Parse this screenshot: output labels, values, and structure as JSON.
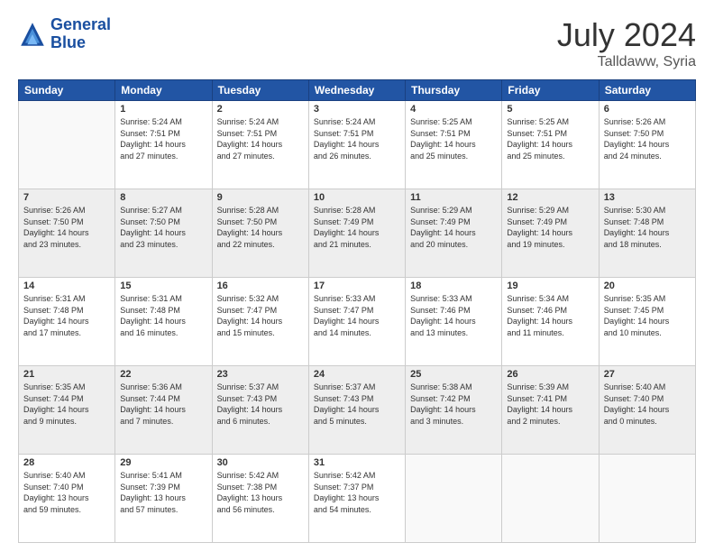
{
  "header": {
    "logo_line1": "General",
    "logo_line2": "Blue",
    "month_year": "July 2024",
    "location": "Talldaww, Syria"
  },
  "weekdays": [
    "Sunday",
    "Monday",
    "Tuesday",
    "Wednesday",
    "Thursday",
    "Friday",
    "Saturday"
  ],
  "weeks": [
    [
      {
        "day": "",
        "info": ""
      },
      {
        "day": "1",
        "info": "Sunrise: 5:24 AM\nSunset: 7:51 PM\nDaylight: 14 hours\nand 27 minutes."
      },
      {
        "day": "2",
        "info": "Sunrise: 5:24 AM\nSunset: 7:51 PM\nDaylight: 14 hours\nand 27 minutes."
      },
      {
        "day": "3",
        "info": "Sunrise: 5:24 AM\nSunset: 7:51 PM\nDaylight: 14 hours\nand 26 minutes."
      },
      {
        "day": "4",
        "info": "Sunrise: 5:25 AM\nSunset: 7:51 PM\nDaylight: 14 hours\nand 25 minutes."
      },
      {
        "day": "5",
        "info": "Sunrise: 5:25 AM\nSunset: 7:51 PM\nDaylight: 14 hours\nand 25 minutes."
      },
      {
        "day": "6",
        "info": "Sunrise: 5:26 AM\nSunset: 7:50 PM\nDaylight: 14 hours\nand 24 minutes."
      }
    ],
    [
      {
        "day": "7",
        "info": "Sunrise: 5:26 AM\nSunset: 7:50 PM\nDaylight: 14 hours\nand 23 minutes."
      },
      {
        "day": "8",
        "info": "Sunrise: 5:27 AM\nSunset: 7:50 PM\nDaylight: 14 hours\nand 23 minutes."
      },
      {
        "day": "9",
        "info": "Sunrise: 5:28 AM\nSunset: 7:50 PM\nDaylight: 14 hours\nand 22 minutes."
      },
      {
        "day": "10",
        "info": "Sunrise: 5:28 AM\nSunset: 7:49 PM\nDaylight: 14 hours\nand 21 minutes."
      },
      {
        "day": "11",
        "info": "Sunrise: 5:29 AM\nSunset: 7:49 PM\nDaylight: 14 hours\nand 20 minutes."
      },
      {
        "day": "12",
        "info": "Sunrise: 5:29 AM\nSunset: 7:49 PM\nDaylight: 14 hours\nand 19 minutes."
      },
      {
        "day": "13",
        "info": "Sunrise: 5:30 AM\nSunset: 7:48 PM\nDaylight: 14 hours\nand 18 minutes."
      }
    ],
    [
      {
        "day": "14",
        "info": "Sunrise: 5:31 AM\nSunset: 7:48 PM\nDaylight: 14 hours\nand 17 minutes."
      },
      {
        "day": "15",
        "info": "Sunrise: 5:31 AM\nSunset: 7:48 PM\nDaylight: 14 hours\nand 16 minutes."
      },
      {
        "day": "16",
        "info": "Sunrise: 5:32 AM\nSunset: 7:47 PM\nDaylight: 14 hours\nand 15 minutes."
      },
      {
        "day": "17",
        "info": "Sunrise: 5:33 AM\nSunset: 7:47 PM\nDaylight: 14 hours\nand 14 minutes."
      },
      {
        "day": "18",
        "info": "Sunrise: 5:33 AM\nSunset: 7:46 PM\nDaylight: 14 hours\nand 13 minutes."
      },
      {
        "day": "19",
        "info": "Sunrise: 5:34 AM\nSunset: 7:46 PM\nDaylight: 14 hours\nand 11 minutes."
      },
      {
        "day": "20",
        "info": "Sunrise: 5:35 AM\nSunset: 7:45 PM\nDaylight: 14 hours\nand 10 minutes."
      }
    ],
    [
      {
        "day": "21",
        "info": "Sunrise: 5:35 AM\nSunset: 7:44 PM\nDaylight: 14 hours\nand 9 minutes."
      },
      {
        "day": "22",
        "info": "Sunrise: 5:36 AM\nSunset: 7:44 PM\nDaylight: 14 hours\nand 7 minutes."
      },
      {
        "day": "23",
        "info": "Sunrise: 5:37 AM\nSunset: 7:43 PM\nDaylight: 14 hours\nand 6 minutes."
      },
      {
        "day": "24",
        "info": "Sunrise: 5:37 AM\nSunset: 7:43 PM\nDaylight: 14 hours\nand 5 minutes."
      },
      {
        "day": "25",
        "info": "Sunrise: 5:38 AM\nSunset: 7:42 PM\nDaylight: 14 hours\nand 3 minutes."
      },
      {
        "day": "26",
        "info": "Sunrise: 5:39 AM\nSunset: 7:41 PM\nDaylight: 14 hours\nand 2 minutes."
      },
      {
        "day": "27",
        "info": "Sunrise: 5:40 AM\nSunset: 7:40 PM\nDaylight: 14 hours\nand 0 minutes."
      }
    ],
    [
      {
        "day": "28",
        "info": "Sunrise: 5:40 AM\nSunset: 7:40 PM\nDaylight: 13 hours\nand 59 minutes."
      },
      {
        "day": "29",
        "info": "Sunrise: 5:41 AM\nSunset: 7:39 PM\nDaylight: 13 hours\nand 57 minutes."
      },
      {
        "day": "30",
        "info": "Sunrise: 5:42 AM\nSunset: 7:38 PM\nDaylight: 13 hours\nand 56 minutes."
      },
      {
        "day": "31",
        "info": "Sunrise: 5:42 AM\nSunset: 7:37 PM\nDaylight: 13 hours\nand 54 minutes."
      },
      {
        "day": "",
        "info": ""
      },
      {
        "day": "",
        "info": ""
      },
      {
        "day": "",
        "info": ""
      }
    ]
  ],
  "row_colors": [
    "#ffffff",
    "#eeeeee",
    "#ffffff",
    "#eeeeee",
    "#ffffff"
  ]
}
